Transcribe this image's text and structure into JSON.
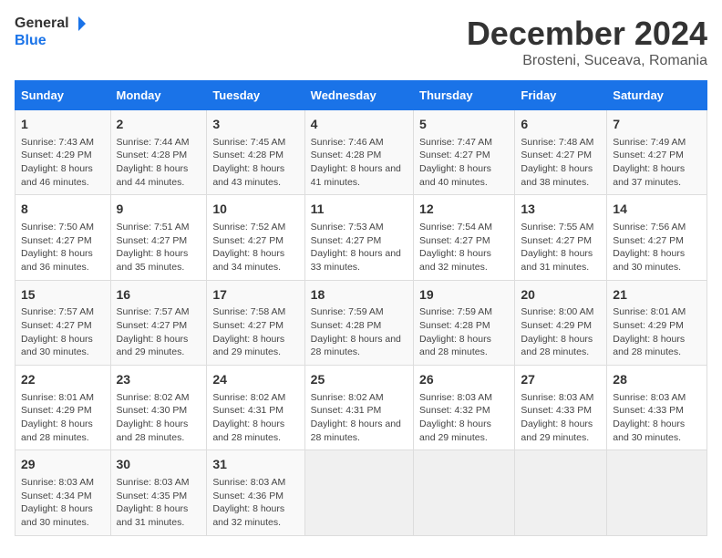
{
  "logo": {
    "line1": "General",
    "line2": "Blue"
  },
  "title": "December 2024",
  "subtitle": "Brosteni, Suceava, Romania",
  "days_header": [
    "Sunday",
    "Monday",
    "Tuesday",
    "Wednesday",
    "Thursday",
    "Friday",
    "Saturday"
  ],
  "weeks": [
    [
      {
        "day": "1",
        "sunrise": "Sunrise: 7:43 AM",
        "sunset": "Sunset: 4:29 PM",
        "daylight": "Daylight: 8 hours and 46 minutes."
      },
      {
        "day": "2",
        "sunrise": "Sunrise: 7:44 AM",
        "sunset": "Sunset: 4:28 PM",
        "daylight": "Daylight: 8 hours and 44 minutes."
      },
      {
        "day": "3",
        "sunrise": "Sunrise: 7:45 AM",
        "sunset": "Sunset: 4:28 PM",
        "daylight": "Daylight: 8 hours and 43 minutes."
      },
      {
        "day": "4",
        "sunrise": "Sunrise: 7:46 AM",
        "sunset": "Sunset: 4:28 PM",
        "daylight": "Daylight: 8 hours and 41 minutes."
      },
      {
        "day": "5",
        "sunrise": "Sunrise: 7:47 AM",
        "sunset": "Sunset: 4:27 PM",
        "daylight": "Daylight: 8 hours and 40 minutes."
      },
      {
        "day": "6",
        "sunrise": "Sunrise: 7:48 AM",
        "sunset": "Sunset: 4:27 PM",
        "daylight": "Daylight: 8 hours and 38 minutes."
      },
      {
        "day": "7",
        "sunrise": "Sunrise: 7:49 AM",
        "sunset": "Sunset: 4:27 PM",
        "daylight": "Daylight: 8 hours and 37 minutes."
      }
    ],
    [
      {
        "day": "8",
        "sunrise": "Sunrise: 7:50 AM",
        "sunset": "Sunset: 4:27 PM",
        "daylight": "Daylight: 8 hours and 36 minutes."
      },
      {
        "day": "9",
        "sunrise": "Sunrise: 7:51 AM",
        "sunset": "Sunset: 4:27 PM",
        "daylight": "Daylight: 8 hours and 35 minutes."
      },
      {
        "day": "10",
        "sunrise": "Sunrise: 7:52 AM",
        "sunset": "Sunset: 4:27 PM",
        "daylight": "Daylight: 8 hours and 34 minutes."
      },
      {
        "day": "11",
        "sunrise": "Sunrise: 7:53 AM",
        "sunset": "Sunset: 4:27 PM",
        "daylight": "Daylight: 8 hours and 33 minutes."
      },
      {
        "day": "12",
        "sunrise": "Sunrise: 7:54 AM",
        "sunset": "Sunset: 4:27 PM",
        "daylight": "Daylight: 8 hours and 32 minutes."
      },
      {
        "day": "13",
        "sunrise": "Sunrise: 7:55 AM",
        "sunset": "Sunset: 4:27 PM",
        "daylight": "Daylight: 8 hours and 31 minutes."
      },
      {
        "day": "14",
        "sunrise": "Sunrise: 7:56 AM",
        "sunset": "Sunset: 4:27 PM",
        "daylight": "Daylight: 8 hours and 30 minutes."
      }
    ],
    [
      {
        "day": "15",
        "sunrise": "Sunrise: 7:57 AM",
        "sunset": "Sunset: 4:27 PM",
        "daylight": "Daylight: 8 hours and 30 minutes."
      },
      {
        "day": "16",
        "sunrise": "Sunrise: 7:57 AM",
        "sunset": "Sunset: 4:27 PM",
        "daylight": "Daylight: 8 hours and 29 minutes."
      },
      {
        "day": "17",
        "sunrise": "Sunrise: 7:58 AM",
        "sunset": "Sunset: 4:27 PM",
        "daylight": "Daylight: 8 hours and 29 minutes."
      },
      {
        "day": "18",
        "sunrise": "Sunrise: 7:59 AM",
        "sunset": "Sunset: 4:28 PM",
        "daylight": "Daylight: 8 hours and 28 minutes."
      },
      {
        "day": "19",
        "sunrise": "Sunrise: 7:59 AM",
        "sunset": "Sunset: 4:28 PM",
        "daylight": "Daylight: 8 hours and 28 minutes."
      },
      {
        "day": "20",
        "sunrise": "Sunrise: 8:00 AM",
        "sunset": "Sunset: 4:29 PM",
        "daylight": "Daylight: 8 hours and 28 minutes."
      },
      {
        "day": "21",
        "sunrise": "Sunrise: 8:01 AM",
        "sunset": "Sunset: 4:29 PM",
        "daylight": "Daylight: 8 hours and 28 minutes."
      }
    ],
    [
      {
        "day": "22",
        "sunrise": "Sunrise: 8:01 AM",
        "sunset": "Sunset: 4:29 PM",
        "daylight": "Daylight: 8 hours and 28 minutes."
      },
      {
        "day": "23",
        "sunrise": "Sunrise: 8:02 AM",
        "sunset": "Sunset: 4:30 PM",
        "daylight": "Daylight: 8 hours and 28 minutes."
      },
      {
        "day": "24",
        "sunrise": "Sunrise: 8:02 AM",
        "sunset": "Sunset: 4:31 PM",
        "daylight": "Daylight: 8 hours and 28 minutes."
      },
      {
        "day": "25",
        "sunrise": "Sunrise: 8:02 AM",
        "sunset": "Sunset: 4:31 PM",
        "daylight": "Daylight: 8 hours and 28 minutes."
      },
      {
        "day": "26",
        "sunrise": "Sunrise: 8:03 AM",
        "sunset": "Sunset: 4:32 PM",
        "daylight": "Daylight: 8 hours and 29 minutes."
      },
      {
        "day": "27",
        "sunrise": "Sunrise: 8:03 AM",
        "sunset": "Sunset: 4:33 PM",
        "daylight": "Daylight: 8 hours and 29 minutes."
      },
      {
        "day": "28",
        "sunrise": "Sunrise: 8:03 AM",
        "sunset": "Sunset: 4:33 PM",
        "daylight": "Daylight: 8 hours and 30 minutes."
      }
    ],
    [
      {
        "day": "29",
        "sunrise": "Sunrise: 8:03 AM",
        "sunset": "Sunset: 4:34 PM",
        "daylight": "Daylight: 8 hours and 30 minutes."
      },
      {
        "day": "30",
        "sunrise": "Sunrise: 8:03 AM",
        "sunset": "Sunset: 4:35 PM",
        "daylight": "Daylight: 8 hours and 31 minutes."
      },
      {
        "day": "31",
        "sunrise": "Sunrise: 8:03 AM",
        "sunset": "Sunset: 4:36 PM",
        "daylight": "Daylight: 8 hours and 32 minutes."
      },
      null,
      null,
      null,
      null
    ]
  ]
}
